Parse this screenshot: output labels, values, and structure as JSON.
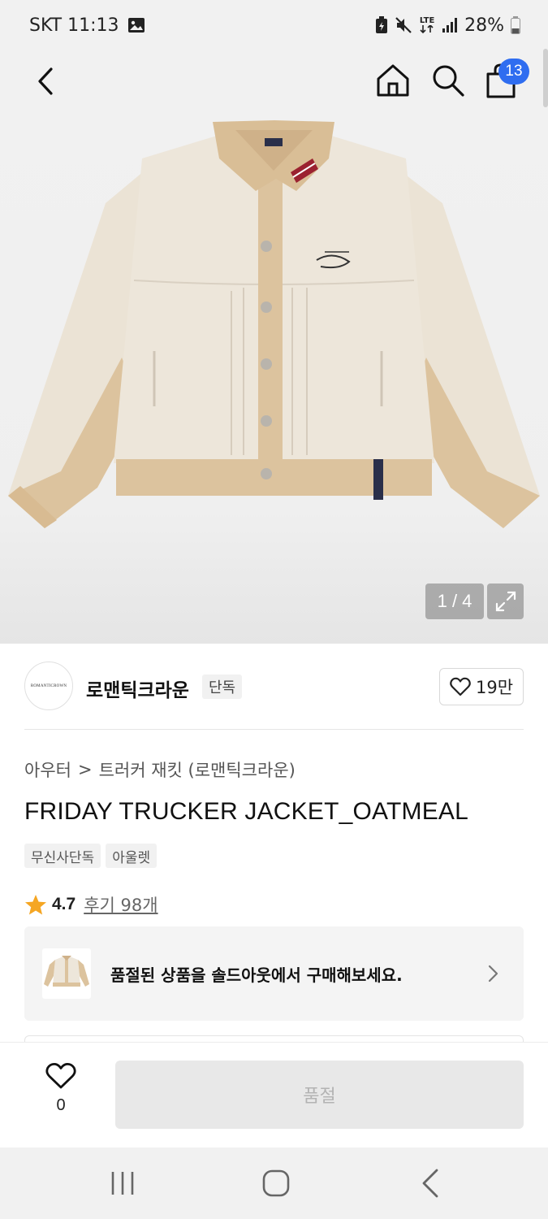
{
  "status_bar": {
    "carrier_time": "SKT 11:13",
    "network": "LTE",
    "battery": "28%",
    "icons": [
      "gallery-icon",
      "battery-saver-icon",
      "mute-icon",
      "lte-icon",
      "signal-icon",
      "battery-icon"
    ]
  },
  "nav": {
    "icons": [
      "back-icon",
      "home-icon",
      "search-icon",
      "cart-icon"
    ],
    "cart_count": "13"
  },
  "gallery": {
    "counter": "1 / 4",
    "current_index": 1,
    "total": 4
  },
  "brand": {
    "logo_text": "ROMANTICROWN",
    "name": "로맨틱크라운",
    "exclusive_tag": "단독",
    "likes": "19만"
  },
  "product": {
    "breadcrumb_category": "아우터",
    "breadcrumb_separator": ">",
    "breadcrumb_sub": "트러커 재킷 (로맨틱크라운)",
    "title": "FRIDAY TRUCKER JACKET_OATMEAL",
    "tags": [
      "무신사단독",
      "아울렛"
    ],
    "rating": "4.7",
    "rating_value": 4.7,
    "reviews": "후기 98개"
  },
  "soldout_banner": {
    "text": "품절된 상품을 솔드아웃에서 구매해보세요."
  },
  "bottom_bar": {
    "wish_count": "0",
    "buy_label": "품절"
  },
  "colors": {
    "badge_blue": "#2f6df0",
    "star": "#f5a623",
    "disabled_btn": "#e8e8e8"
  }
}
